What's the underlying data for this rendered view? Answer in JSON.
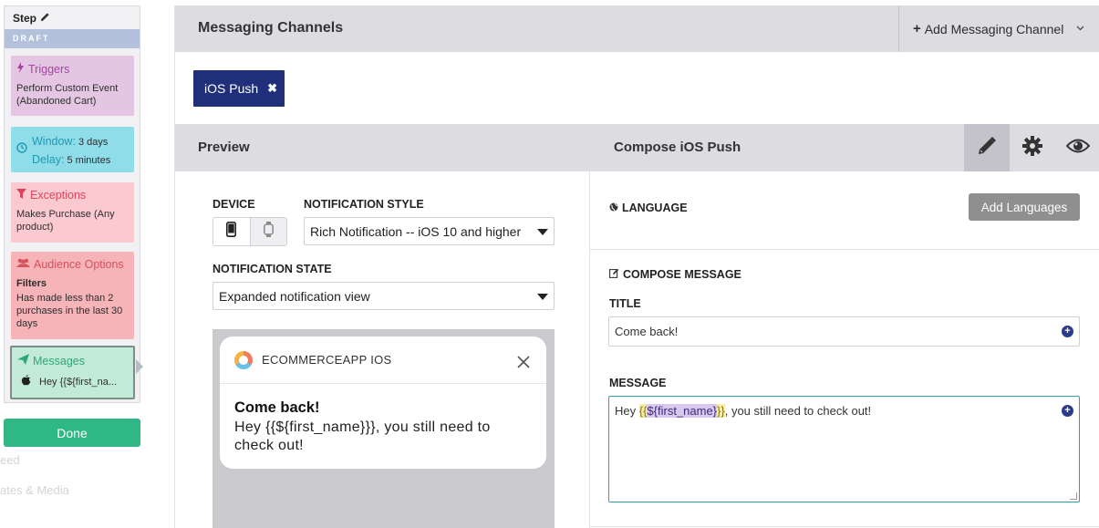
{
  "background": {
    "ghost_1": "eed",
    "ghost_2": "ates & Media"
  },
  "step_panel": {
    "title": "Step",
    "status": "DRAFT",
    "triggers": {
      "title": "Triggers",
      "body": "Perform Custom Event (Abandoned Cart)"
    },
    "window": {
      "window_label": "Window:",
      "window_value": "3 days",
      "delay_label": "Delay:",
      "delay_value": "5 minutes"
    },
    "exceptions": {
      "title": "Exceptions",
      "body": "Makes Purchase (Any product)"
    },
    "audience": {
      "title": "Audience Options",
      "filters_label": "Filters",
      "body": "Has made less than 2 purchases in the last 30 days"
    },
    "messages": {
      "title": "Messages",
      "item": "Hey {{${first_na..."
    },
    "done_label": "Done"
  },
  "header": {
    "title": "Messaging Channels",
    "add_channel": "Add Messaging Channel"
  },
  "channel_tag": "iOS Push",
  "sub_header": {
    "preview": "Preview",
    "compose": "Compose iOS Push"
  },
  "preview": {
    "device_label": "DEVICE",
    "style_label": "NOTIFICATION STYLE",
    "style_value": "Rich Notification -- iOS 10 and higher",
    "state_label": "NOTIFICATION STATE",
    "state_value": "Expanded notification view",
    "notification": {
      "app_name": "ECOMMERCEAPP IOS",
      "title": "Come back!",
      "body": "Hey {{${first_name}}}, you still need to check out!"
    }
  },
  "compose": {
    "language_label": "LANGUAGE",
    "add_languages": "Add Languages",
    "compose_label": "COMPOSE MESSAGE",
    "title_label": "TITLE",
    "title_value": "Come back!",
    "message_label": "MESSAGE",
    "message_prefix": "Hey ",
    "message_open": "{{",
    "message_var": "${first_name}",
    "message_close": "}}",
    "message_suffix": ", you still need to check out!"
  },
  "colors": {
    "accent_navy": "#1f2f7a",
    "done_green": "#2fb886",
    "teal_border": "#2f9fae"
  }
}
